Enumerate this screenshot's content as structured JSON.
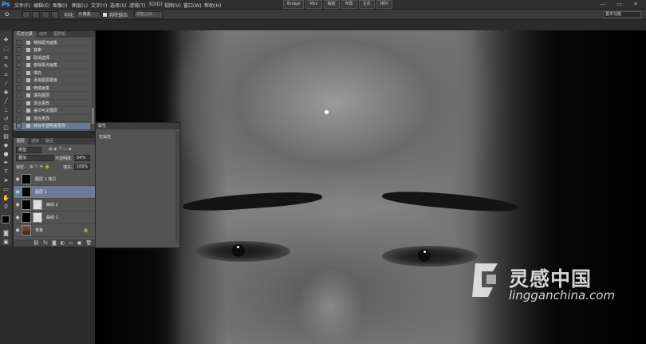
{
  "menubar": {
    "logo": "Ps",
    "items": [
      "文件(F)",
      "编辑(E)",
      "图像(I)",
      "图层(L)",
      "文字(Y)",
      "选择(S)",
      "滤镜(T)",
      "3D(D)",
      "视图(V)",
      "窗口(W)",
      "帮助(H)"
    ],
    "center_buttons": [
      "Bridge",
      "Mini",
      "缩放",
      "布局",
      "主页",
      "排列"
    ],
    "window_controls": "— ▭ ✕"
  },
  "options_bar": {
    "feather_label": "羽化:",
    "feather_value": "0 像素",
    "antialias_label": "消除锯齿",
    "refine_edge_button": "调整边缘...",
    "workspace": "基本功能"
  },
  "history_panel": {
    "tabs": [
      "历史记录",
      "动作",
      "图层组"
    ],
    "items": [
      {
        "label": "移除斑点画笔",
        "selected": false
      },
      {
        "label": "套索",
        "selected": false
      },
      {
        "label": "取消选择",
        "selected": false
      },
      {
        "label": "移除斑点画笔",
        "selected": false
      },
      {
        "label": "填充",
        "selected": false
      },
      {
        "label": "添加图层蒙版",
        "selected": false
      },
      {
        "label": "修缮画笔",
        "selected": false
      },
      {
        "label": "填充图层",
        "selected": false
      },
      {
        "label": "混合更改",
        "selected": false
      },
      {
        "label": "盖印可见图层",
        "selected": false
      },
      {
        "label": "混合更改",
        "selected": false
      },
      {
        "label": "目标不透明度更改",
        "selected": true
      }
    ]
  },
  "layers_panel": {
    "tabs": [
      "图层",
      "通道",
      "路径"
    ],
    "filter_kind": "类型",
    "blend_mode": "叠加",
    "opacity_label": "不透明度:",
    "opacity_value": "54%",
    "lock_label": "锁定:",
    "fill_label": "填充:",
    "fill_value": "100%",
    "layers": [
      {
        "name": "图层 1 拷贝",
        "selected": false,
        "thumb": "black"
      },
      {
        "name": "图层 1",
        "selected": true,
        "thumb": "black"
      },
      {
        "name": "曲线 2",
        "selected": false,
        "thumb": "black"
      },
      {
        "name": "曲线 1",
        "selected": false,
        "thumb": "black"
      },
      {
        "name": "背景",
        "selected": false,
        "thumb": "face"
      }
    ]
  },
  "properties_panel": {
    "title": "属性",
    "empty_text": "无属性"
  },
  "watermark": {
    "title": "灵感中国",
    "url": "lingganchina.com"
  }
}
